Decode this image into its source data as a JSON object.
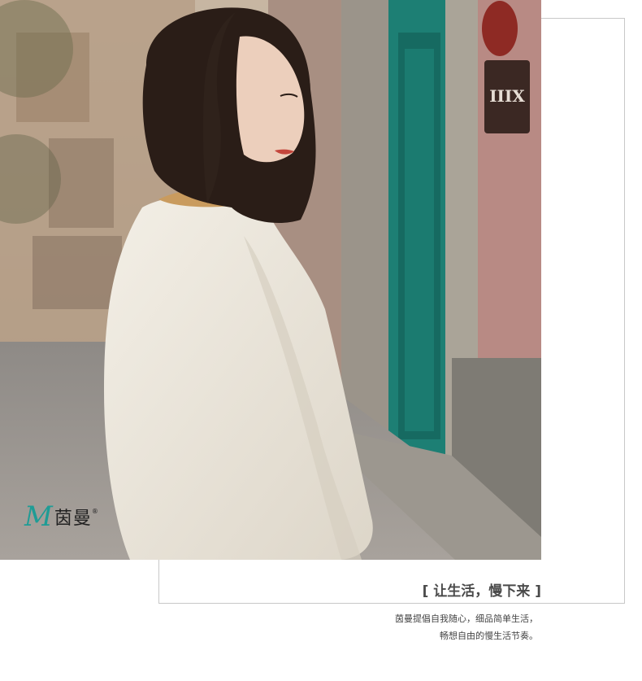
{
  "brand": {
    "logo_mark": "M",
    "logo_text": "茵曼",
    "registered": "®",
    "accent_color": "#1f9c95"
  },
  "tagline": {
    "open_bracket": "[",
    "text": "让生活，慢下来",
    "close_bracket": "]"
  },
  "description": {
    "line1": "茵曼提倡自我随心，细品简单生活，",
    "line2": "畅想自由的慢生活节奏。"
  },
  "photo": {
    "sign_text": "IIIX"
  }
}
